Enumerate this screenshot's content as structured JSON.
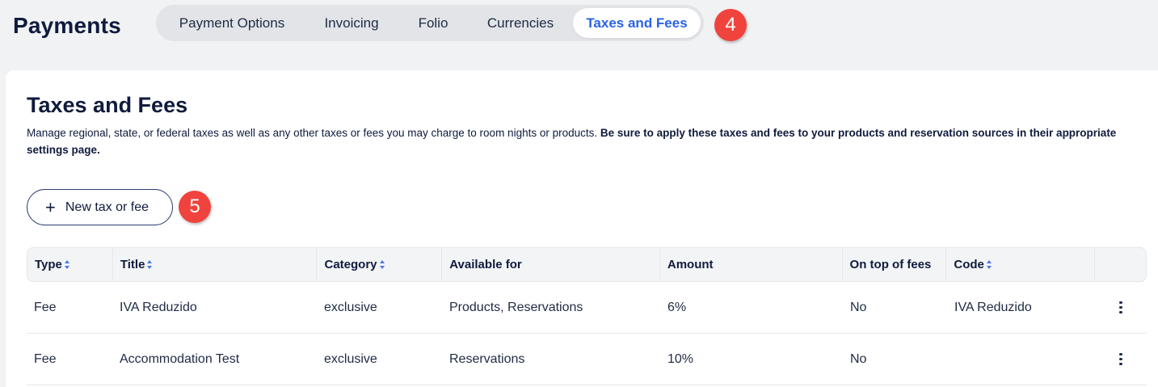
{
  "header": {
    "title": "Payments",
    "tabs": [
      {
        "label": "Payment Options"
      },
      {
        "label": "Invoicing"
      },
      {
        "label": "Folio"
      },
      {
        "label": "Currencies"
      },
      {
        "label": "Taxes and Fees",
        "active": true
      }
    ]
  },
  "badges": {
    "tabs": "4",
    "new_button": "5"
  },
  "section": {
    "title": "Taxes and Fees",
    "description": "Manage regional, state, or federal taxes as well as any other taxes or fees you may charge to room nights or products.",
    "description_bold": "Be sure to apply these taxes and fees to your products and reservation sources in their appropriate settings page.",
    "new_button_label": "New tax or fee",
    "new_button_icon": "plus-icon"
  },
  "table": {
    "columns": [
      {
        "label": "Type",
        "sortable": true
      },
      {
        "label": "Title",
        "sortable": true
      },
      {
        "label": "Category",
        "sortable": true
      },
      {
        "label": "Available for",
        "sortable": false
      },
      {
        "label": "Amount",
        "sortable": false
      },
      {
        "label": "On top of fees",
        "sortable": false
      },
      {
        "label": "Code",
        "sortable": true
      },
      {
        "label": "",
        "sortable": false
      }
    ],
    "rows": [
      {
        "type": "Fee",
        "title": "IVA Reduzido",
        "category": "exclusive",
        "available_for": "Products, Reservations",
        "amount": "6%",
        "on_top_of_fees": "No",
        "code": "IVA Reduzido"
      },
      {
        "type": "Fee",
        "title": "Accommodation Test",
        "category": "exclusive",
        "available_for": "Reservations",
        "amount": "10%",
        "on_top_of_fees": "No",
        "code": ""
      }
    ]
  },
  "colors": {
    "accent": "#2a62e8",
    "badge": "#f0433d",
    "text": "#0f1b3d"
  }
}
